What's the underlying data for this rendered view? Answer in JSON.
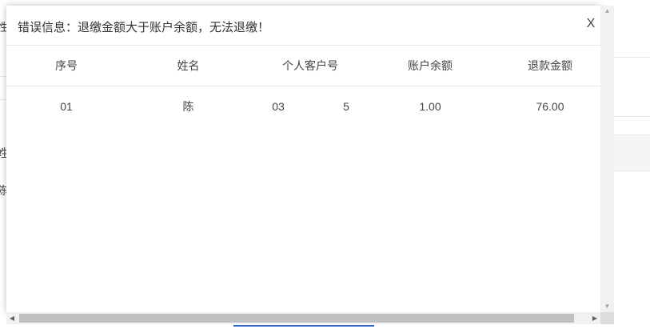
{
  "background": {
    "fragments": [
      "性",
      "姓",
      "陈"
    ]
  },
  "modal": {
    "title": "错误信息：退缴金额大于账户余额，无法退缴！",
    "close_label": "X",
    "table": {
      "headers": [
        "序号",
        "姓名",
        "个人客户号",
        "账户余额",
        "退款金额"
      ],
      "rows": [
        {
          "index": "01",
          "name": "陈",
          "customer_no_a": "03",
          "customer_no_b": "5",
          "balance": "1.00",
          "refund": "76.00"
        }
      ]
    }
  },
  "scrollbars": {
    "up_icon": "▲",
    "down_icon": "▼",
    "left_icon": "◀",
    "right_icon": "▶"
  }
}
